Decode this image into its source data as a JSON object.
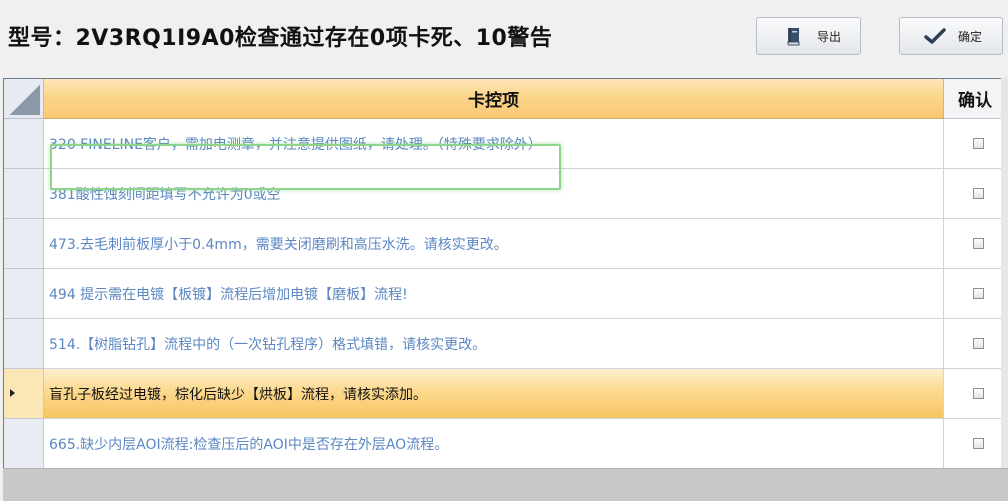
{
  "header": {
    "title": "型号：2V3RQ1I9A0检查通过存在0项卡死、10警告"
  },
  "buttons": {
    "export_label": "导出",
    "confirm_label": "确定",
    "export_icon": "book-icon",
    "confirm_icon": "checkmark-icon"
  },
  "grid": {
    "columns": [
      "卡控项",
      "确认"
    ],
    "rows": [
      {
        "text": "320 FINELINE客户，需加电测章，并注意提供图纸，请处理。（特殊要求除外）",
        "checked": false
      },
      {
        "text": "381酸性蚀刻间距填写不允许为0或空",
        "checked": false
      },
      {
        "text": "473.去毛刺前板厚小于0.4mm，需要关闭磨刷和高压水洗。请核实更改。",
        "checked": false
      },
      {
        "text": "494 提示需在电镀【板镀】流程后增加电镀【磨板】流程!",
        "checked": false
      },
      {
        "text": "514.【树脂钻孔】流程中的（一次钻孔程序）格式填错，请核实更改。",
        "checked": false
      },
      {
        "text": "盲孔子板经过电镀，棕化后缺少【烘板】流程，请核实添加。",
        "checked": false
      },
      {
        "text": "665.缺少内层AOI流程:检查压后的AOI中是否存在外层AO流程。",
        "checked": false
      }
    ],
    "selected_row": 5
  },
  "colors": {
    "header_gold": "#f9c874",
    "link_blue": "#5b87c3",
    "highlight_green": "#8ed48a"
  }
}
